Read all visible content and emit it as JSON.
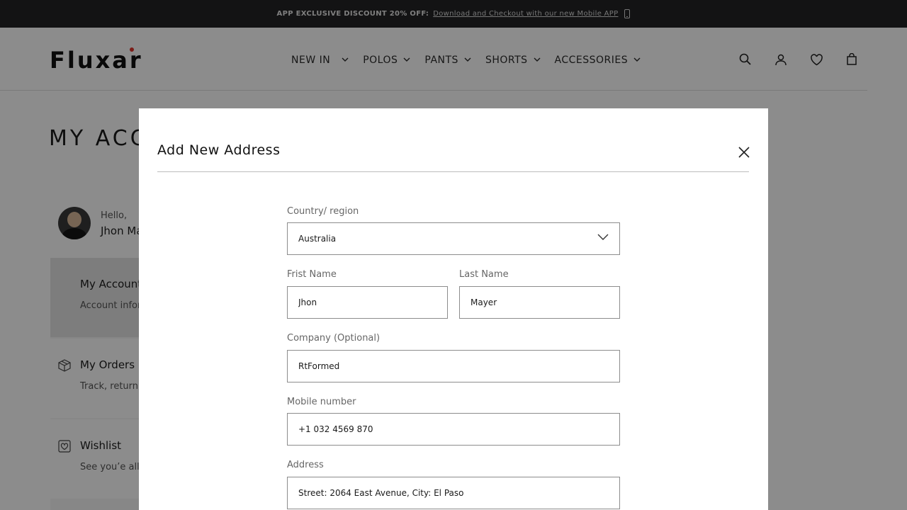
{
  "promo": {
    "lead": "APP EXCLUSIVE DISCOUNT 20% OFF:",
    "link": "Download and Checkout with our new Mobile APP",
    "icon": "mobile-phone-icon"
  },
  "header": {
    "logo": "Fluxar",
    "nav": [
      {
        "label": "NEW IN"
      },
      {
        "label": "POLOS"
      },
      {
        "label": "PANTS"
      },
      {
        "label": "SHORTS"
      },
      {
        "label": "ACCESSORIES"
      }
    ],
    "icons": [
      "search-icon",
      "user-icon",
      "heart-icon",
      "bag-icon"
    ]
  },
  "page": {
    "title": "MY ACCO"
  },
  "sidebar": {
    "hello": "Hello,",
    "user_name": "Jhon Ma",
    "items": [
      {
        "title": "My Account",
        "subtitle": "Account infor",
        "icon": ""
      },
      {
        "title": "My Orders",
        "subtitle": "Track, return,",
        "icon": "box-icon"
      },
      {
        "title": "Wishlist",
        "subtitle": "See you’e all t",
        "icon": "heart-box-icon"
      }
    ]
  },
  "modal": {
    "title": "Add New Address",
    "country": {
      "label": "Country/ region",
      "value": "Australia"
    },
    "first_name": {
      "label": "Frist Name",
      "value": "Jhon"
    },
    "last_name": {
      "label": "Last Name",
      "value": "Mayer"
    },
    "company": {
      "label": "Company (Optional)",
      "value": "RtFormed"
    },
    "mobile": {
      "label": "Mobile number",
      "value": "+1 032 4569 870"
    },
    "address": {
      "label": "Address",
      "value": "Street: 2064 East Avenue, City: El Paso"
    }
  },
  "colors": {
    "promo_bg": "#232426",
    "overlay": "rgba(0,0,0,0.45)",
    "logo_accent": "#e0362c"
  }
}
